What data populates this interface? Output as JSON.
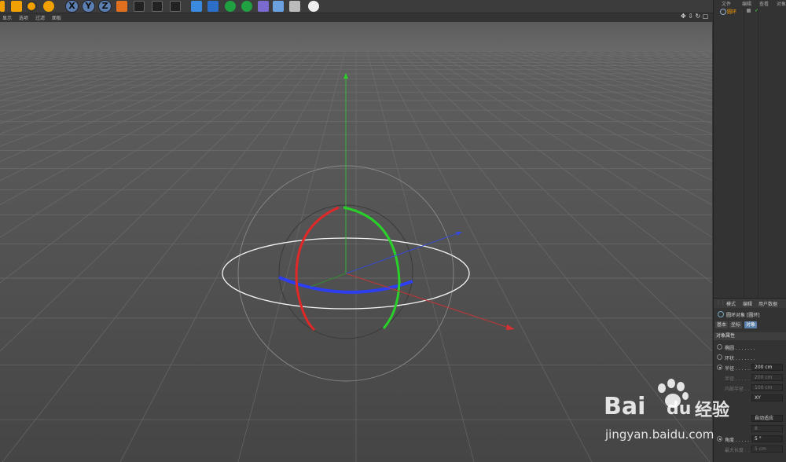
{
  "menubar": {
    "items": [
      "显示",
      "选项",
      "过滤",
      "面板"
    ]
  },
  "toolbar": {
    "axis_x": "X",
    "axis_y": "Y",
    "axis_z": "Z"
  },
  "objects_panel": {
    "menu": [
      "文件",
      "编辑",
      "查看",
      "对象"
    ],
    "object_name": "圆环"
  },
  "attributes_panel": {
    "menu": [
      "模式",
      "编辑",
      "用户数据"
    ],
    "title": "圆环对象 [圆环]",
    "tabs": [
      "基本",
      "坐标",
      "对象"
    ],
    "section": "对象属性",
    "props": [
      {
        "label": "椭圆 . . . . . . .",
        "value": "",
        "radio": true,
        "dim": false
      },
      {
        "label": "环状 . . . . . . .",
        "value": "",
        "radio": true,
        "dim": false
      },
      {
        "label": "半径 . . . . . . .",
        "value": "200 cm",
        "radio": true,
        "dim": false
      },
      {
        "label": "半径 . . . . . .",
        "value": "200 cm",
        "radio": false,
        "dim": true
      },
      {
        "label": "内部半径 . . .",
        "value": "100 cm",
        "radio": false,
        "dim": true
      },
      {
        "label": "",
        "value": "XY",
        "radio": false,
        "dim": false
      },
      {
        "label": "",
        "value": "",
        "radio": true,
        "dim": false
      },
      {
        "label": "",
        "value": "自动适应",
        "radio": false,
        "dim": false
      },
      {
        "label": "",
        "value": "8",
        "radio": false,
        "dim": true
      },
      {
        "label": "角度 . . . . . . .",
        "value": "5 °",
        "radio": true,
        "dim": false
      },
      {
        "label": "最大长度 . . .",
        "value": "5 cm",
        "radio": false,
        "dim": true
      }
    ]
  },
  "watermark": {
    "brand": "Bai",
    "brand2": "du",
    "jingyan": "经验",
    "url": "jingyan.baidu.com"
  },
  "colors": {
    "x_axis": "#e03030",
    "y_axis": "#30d030",
    "z_axis": "#3050f0",
    "grid": "#5a5a5a",
    "floor": "#4a4a4a"
  }
}
